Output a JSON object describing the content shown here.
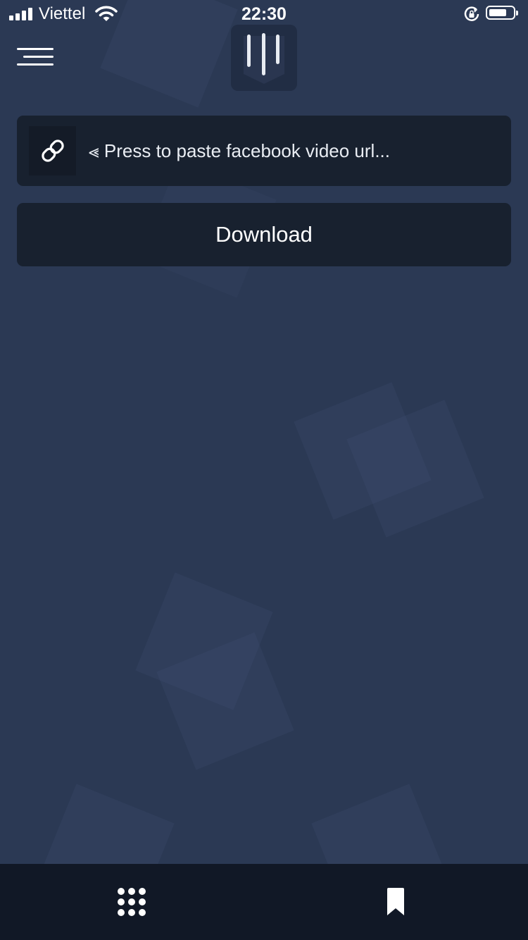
{
  "status_bar": {
    "carrier": "Viettel",
    "time": "22:30",
    "icons": [
      "signal-icon",
      "wifi-icon",
      "rotation-lock-icon",
      "battery-icon"
    ]
  },
  "header": {
    "menu_icon": "hamburger-menu-icon",
    "logo_icon": "app-logo-icon"
  },
  "url_input": {
    "icon": "link-icon",
    "placeholder": "⪡ Press to paste facebook video url..."
  },
  "actions": {
    "download_label": "Download"
  },
  "bottom_nav": {
    "items": [
      {
        "icon": "apps-grid-icon"
      },
      {
        "icon": "bookmark-icon"
      }
    ]
  },
  "colors": {
    "background": "#2b3954",
    "card": "#18212f",
    "bottom_bar": "#111826",
    "text": "#ffffff"
  }
}
